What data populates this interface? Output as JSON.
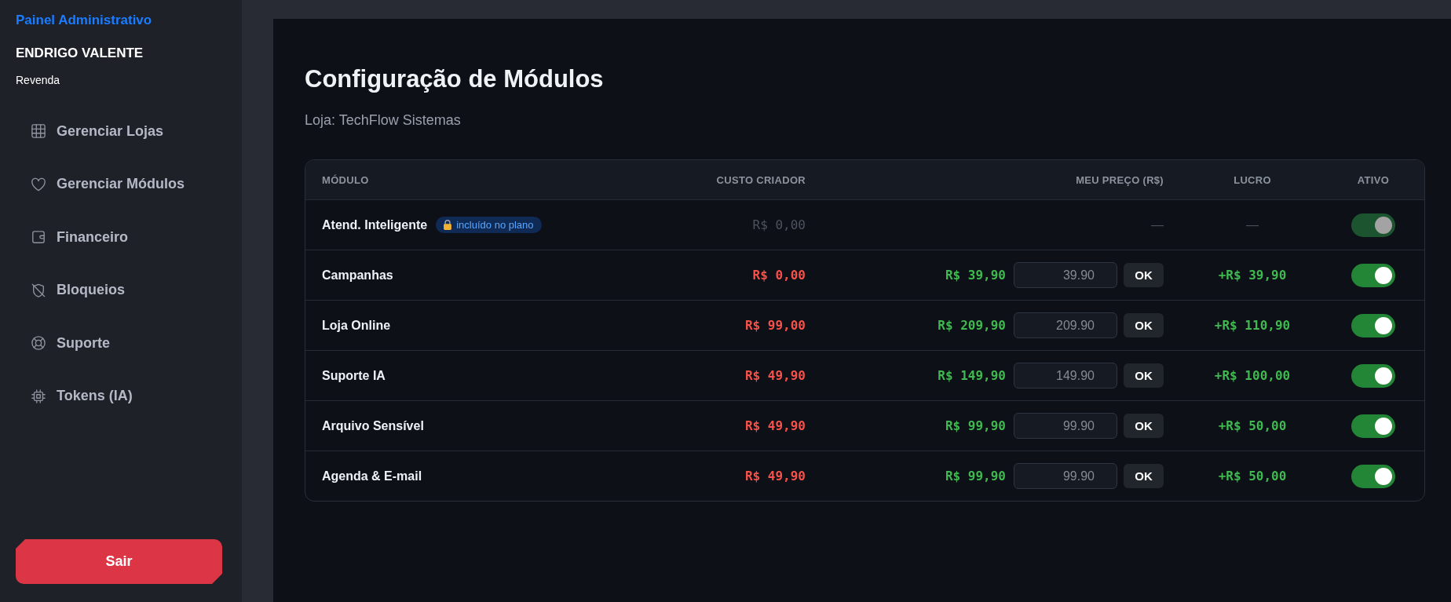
{
  "sidebar": {
    "title": "Painel Administrativo",
    "user_name": "ENDRIGO VALENTE",
    "user_role": "Revenda",
    "items": [
      {
        "label": "Gerenciar Lojas",
        "selected": false
      },
      {
        "label": "Gerenciar Módulos",
        "selected": false
      },
      {
        "label": "Financeiro",
        "selected": false
      },
      {
        "label": "Bloqueios",
        "selected": false
      },
      {
        "label": "Suporte",
        "selected": false
      },
      {
        "label": "Tokens (IA)",
        "selected": false
      }
    ],
    "logout_button": "Sair"
  },
  "page": {
    "title": "Configuração de Módulos",
    "subtitle": "Loja: TechFlow Sistemas"
  },
  "table": {
    "columns": [
      "MÓDULO",
      "CUSTO CRIADOR",
      "MEU PREÇO (R$)",
      "LUCRO",
      "ATIVO"
    ],
    "rows": [
      {
        "kind": "included",
        "name": "Atend. Inteligente",
        "badge": "incluído no plano",
        "cost": "R$ 0,00",
        "price_dash": "—",
        "profit": "—",
        "active": true,
        "disabled": true
      },
      {
        "kind": "custom",
        "name": "Campanhas",
        "cost": "R$ 0,00",
        "price": "R$ 39,90",
        "price_input": {
          "placeholder": "39.90"
        },
        "ok_button": "OK",
        "profit": "+R$ 39,90",
        "active": true,
        "disabled": false
      },
      {
        "kind": "custom",
        "name": "Loja Online",
        "cost": "R$ 99,00",
        "price": "R$ 209,90",
        "price_input": {
          "placeholder": "209.90"
        },
        "ok_button": "OK",
        "profit": "+R$ 110,90",
        "active": true,
        "disabled": false
      },
      {
        "kind": "custom",
        "name": "Suporte IA",
        "cost": "R$ 49,90",
        "price": "R$ 149,90",
        "price_input": {
          "placeholder": "149.90"
        },
        "ok_button": "OK",
        "profit": "+R$ 100,00",
        "active": true,
        "disabled": false
      },
      {
        "kind": "custom",
        "name": "Arquivo Sensível",
        "cost": "R$ 49,90",
        "price": "R$ 99,90",
        "price_input": {
          "placeholder": "99.90"
        },
        "ok_button": "OK",
        "profit": "+R$ 50,00",
        "active": true,
        "disabled": false
      },
      {
        "kind": "custom",
        "name": "Agenda & E-mail",
        "cost": "R$ 49,90",
        "price": "R$ 99,90",
        "price_input": {
          "placeholder": "99.90"
        },
        "ok_button": "OK",
        "profit": "+R$ 50,00",
        "active": true,
        "disabled": false
      }
    ]
  }
}
